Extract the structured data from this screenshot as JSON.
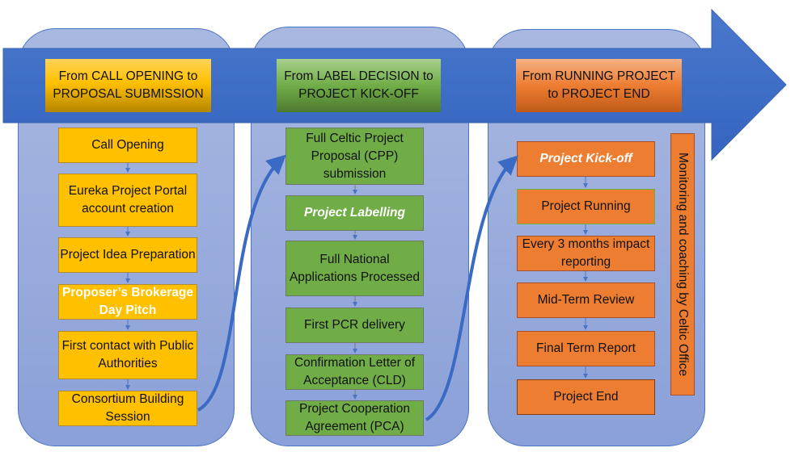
{
  "colors": {
    "arrow": "#3a6ac4",
    "panel": "#a0b2de",
    "yellow": "#ffc000",
    "green": "#70ad47",
    "orange": "#ed7d31"
  },
  "phases": [
    {
      "header": "From CALL OPENING to PROPOSAL SUBMISSION",
      "steps": [
        "Call Opening",
        "Eureka Project Portal account creation",
        "Project Idea Preparation",
        "Proposer’s Brokerage Day Pitch",
        "First contact with Public Authorities",
        "Consortium Building Session"
      ]
    },
    {
      "header": "From LABEL DECISION to PROJECT KICK-OFF",
      "steps": [
        "Full Celtic Project Proposal (CPP) submission",
        "Project Labelling",
        "Full National Applications Processed",
        "First PCR delivery",
        "Confirmation Letter of Acceptance (CLD)",
        "Project Cooperation Agreement (PCA)"
      ]
    },
    {
      "header": "From RUNNING PROJECT to PROJECT END",
      "steps": [
        "Project Kick-off",
        "Project Running",
        "Every 3 months impact reporting",
        "Mid-Term Review",
        "Final Term Report",
        "Project End"
      ],
      "side_note": "Monitoring and coaching by Celtic Office"
    }
  ]
}
